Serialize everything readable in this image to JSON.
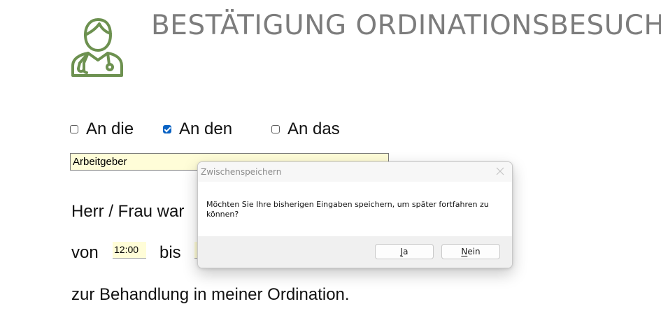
{
  "header": {
    "icon": "doctor-icon",
    "title": "BESTÄTIGUNG ORDINATIONSBESUCH",
    "icon_color": "#6d9150",
    "title_color": "#7c7c7c"
  },
  "recipient": {
    "options": [
      {
        "label": "An die",
        "checked": false
      },
      {
        "label": "An den",
        "checked": true
      },
      {
        "label": "An das",
        "checked": false
      }
    ],
    "field_value": "Arbeitgeber"
  },
  "body": {
    "line1": "Herr / Frau war",
    "from_label": "von",
    "from_time": "12:00",
    "to_label": "bis",
    "to_time": "",
    "line3": "zur Behandlung in meiner Ordination."
  },
  "dialog": {
    "title": "Zwischenspeichern",
    "message": "Möchten Sie Ihre bisherigen Eingaben speichern, um später fortfahren zu können?",
    "yes_mnemonic": "J",
    "yes_rest": "a",
    "no_mnemonic": "N",
    "no_rest": "ein",
    "close_icon": "close-icon"
  },
  "colors": {
    "field_background": "#fffdd8",
    "checkbox_checked": "#0b63c4"
  }
}
